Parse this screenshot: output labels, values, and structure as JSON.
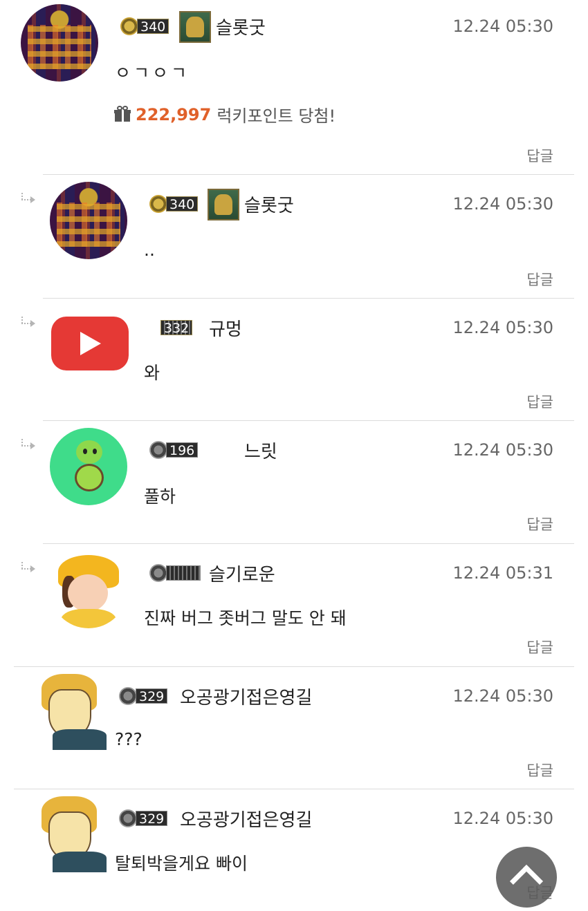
{
  "comments": [
    {
      "level": "340",
      "nickname": "슬롯굿",
      "time": "12.24 05:30",
      "text": "ㅇㄱㅇㄱ",
      "reply": "답글",
      "lucky": {
        "points": "222,997",
        "message": "럭키포인트 당첨!"
      }
    },
    {
      "level": "340",
      "nickname": "슬롯굿",
      "time": "12.24 05:30",
      "text": "..",
      "reply": "답글"
    },
    {
      "level": "332",
      "nickname": "규멍",
      "time": "12.24 05:30",
      "text": "와",
      "reply": "답글"
    },
    {
      "level": "196",
      "nickname": "느릿",
      "time": "12.24 05:30",
      "text": "풀하",
      "reply": "답글"
    },
    {
      "level": "",
      "nickname": "슬기로운",
      "time": "12.24 05:31",
      "text": "진짜 버그 좃버그 말도 안 돼",
      "reply": "답글"
    },
    {
      "level": "329",
      "nickname": "오공광기접은영길",
      "time": "12.24 05:30",
      "text": "???",
      "reply": "답글"
    },
    {
      "level": "329",
      "nickname": "오공광기접은영길",
      "time": "12.24 05:30",
      "text": "탈퇴박을게요 빠이",
      "reply": "답글"
    }
  ],
  "colors": {
    "accent_points": "#e0612a",
    "divider": "#dcdcdc",
    "youtube_red": "#e53935"
  },
  "icons": [
    "reply-arrow-icon",
    "gift-icon",
    "level-emblem-icon",
    "rank-icon",
    "play-icon",
    "chevron-up-icon"
  ]
}
